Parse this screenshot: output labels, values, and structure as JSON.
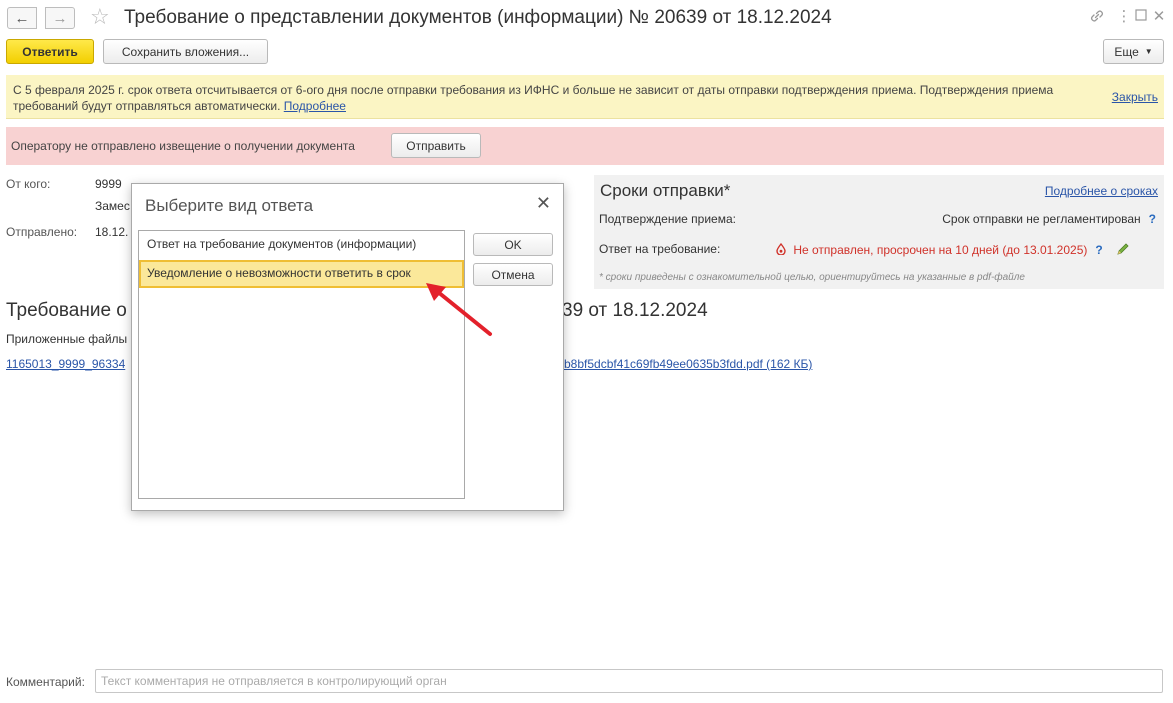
{
  "window": {
    "title": "Требование о представлении документов (информации) № 20639 от 18.12.2024"
  },
  "toolbar": {
    "reply_label": "Ответить",
    "save_attachments_label": "Сохранить вложения...",
    "more_label": "Еще"
  },
  "infobar": {
    "text": "С 5 февраля 2025 г. срок ответа отсчитывается от 6-ого дня после отправки требования из ИФНС и больше не зависит от даты отправки подтверждения приема. Подтверждения приема требований будут отправляться автоматически.",
    "more_link": "Подробнее",
    "close_link": "Закрыть"
  },
  "warnbar": {
    "text": "Оператору не отправлено извещение о получении документа",
    "send_label": "Отправить"
  },
  "fields": {
    "from_label": "От кого:",
    "from_value": "9999",
    "from_value2": "Замес",
    "sent_label": "Отправлено:",
    "sent_value": "18.12."
  },
  "deadlines": {
    "title": "Сроки отправки*",
    "more_link": "Подробнее о сроках",
    "confirm_label": "Подтверждение приема:",
    "confirm_value": "Срок отправки не регламентирован",
    "answer_label": "Ответ на требование:",
    "answer_value": "Не отправлен, просрочен на 10 дней (до 13.01.2025)",
    "help_mark": "?",
    "note": "* сроки приведены с ознакомительной целью, ориентируйтесь на указанные в pdf-файле"
  },
  "main": {
    "heading_left": "Требование о",
    "heading_right": "39 от 18.12.2024",
    "attachments_label": "Приложенные файлы",
    "file_link_left": "1165013_9999_96334",
    "file_link_right": "b8bf5dcbf41c69fb49ee0635b3fdd.pdf (162 КБ)"
  },
  "comment": {
    "label": "Комментарий:",
    "placeholder": "Текст комментария не отправляется в контролирующий орган"
  },
  "dialog": {
    "title": "Выберите вид ответа",
    "items": [
      {
        "label": "Ответ на требование документов (информации)"
      },
      {
        "label": "Уведомление о невозможности ответить в срок"
      }
    ],
    "ok_label": "OK",
    "cancel_label": "Отмена"
  },
  "icons": {
    "back": "arrow-left-icon",
    "forward": "arrow-right-icon",
    "favorite": "star-icon",
    "link": "link-icon",
    "menu": "more-vertical-icon",
    "maximize": "maximize-icon",
    "close": "close-icon",
    "overdue": "drop-icon",
    "edit": "pencil-icon"
  },
  "colors": {
    "primary_button": "#f2cf00",
    "infobar_bg": "#fbf5c4",
    "warnbar_bg": "#f8d2d2",
    "link": "#2a55a8",
    "overdue_text": "#d0322a",
    "selected_item": "#fbe89a",
    "annotation_arrow": "#e3212b"
  }
}
